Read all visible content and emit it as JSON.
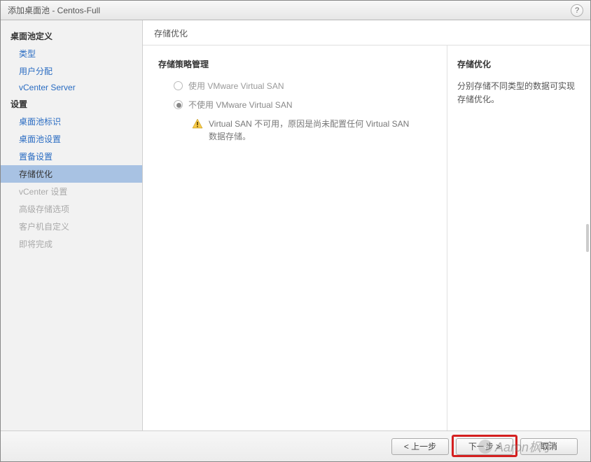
{
  "titlebar": {
    "title": "添加桌面池 - Centos-Full",
    "help_tooltip": "?"
  },
  "sidebar": {
    "groups": [
      {
        "heading": "桌面池定义",
        "items": [
          {
            "label": "类型",
            "state": "done"
          },
          {
            "label": "用户分配",
            "state": "done"
          },
          {
            "label": "vCenter Server",
            "state": "done"
          }
        ]
      },
      {
        "heading": "设置",
        "items": [
          {
            "label": "桌面池标识",
            "state": "done"
          },
          {
            "label": "桌面池设置",
            "state": "done"
          },
          {
            "label": "置备设置",
            "state": "done"
          },
          {
            "label": "存储优化",
            "state": "active"
          },
          {
            "label": "vCenter 设置",
            "state": "disabled"
          },
          {
            "label": "高级存储选项",
            "state": "disabled"
          },
          {
            "label": "客户机自定义",
            "state": "disabled"
          },
          {
            "label": "即将完成",
            "state": "disabled"
          }
        ]
      }
    ]
  },
  "main": {
    "header": "存储优化",
    "center": {
      "subheading": "存储策略管理",
      "options": {
        "use_vsan": "使用 VMware Virtual SAN",
        "no_vsan": "不使用 VMware Virtual SAN"
      },
      "selected": "no_vsan",
      "warning": "Virtual SAN 不可用，原因是尚未配置任何 Virtual SAN 数据存储。"
    },
    "right": {
      "heading": "存储优化",
      "desc": "分别存储不同类型的数据可实现存储优化。"
    }
  },
  "footer": {
    "prev": "< 上一步",
    "next": "下一步 >",
    "cancel": "取消"
  },
  "watermark": {
    "text": "Aaron枫宇"
  }
}
